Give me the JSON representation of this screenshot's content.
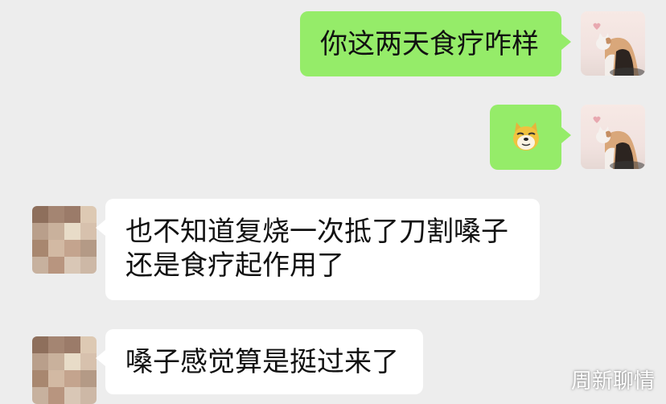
{
  "chat": {
    "messages": [
      {
        "sender": "me",
        "text": "你这两天食疗咋样"
      },
      {
        "sender": "me",
        "emoji": "doge-emoji"
      },
      {
        "sender": "other",
        "lines": [
          "也不知道复烧一次抵了刀割嗓子",
          "还是食疗起作用了"
        ]
      },
      {
        "sender": "other",
        "text": "嗓子感觉算是挺过来了"
      }
    ]
  },
  "watermark": {
    "text": "周新聊情"
  },
  "colors": {
    "background": "#ededed",
    "my_bubble": "#95ec69",
    "their_bubble": "#ffffff"
  }
}
